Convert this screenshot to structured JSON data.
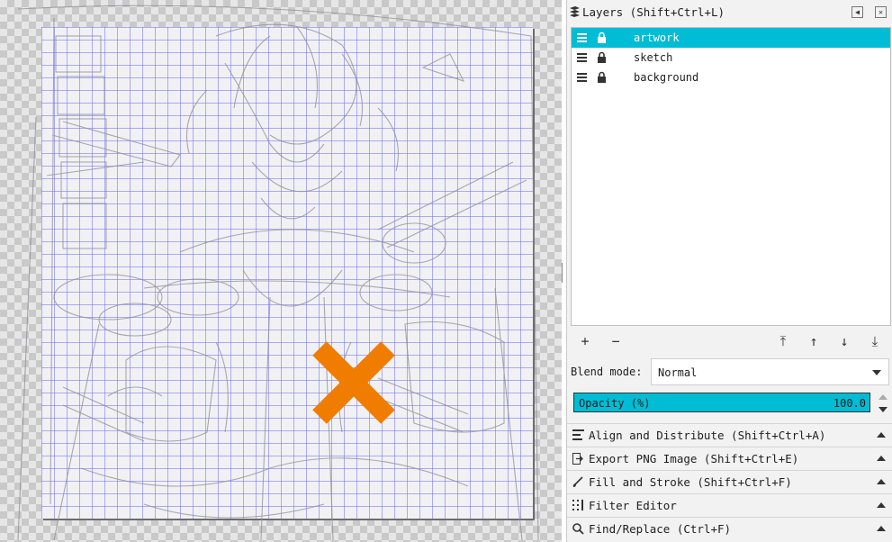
{
  "canvas": {
    "marker_color": "#f07d00"
  },
  "layers_panel": {
    "title": "Layers (Shift+Ctrl+L)",
    "header_icon": "layers-icon",
    "layers": [
      {
        "name": "artwork",
        "selected": true
      },
      {
        "name": "sketch",
        "selected": false
      },
      {
        "name": "background",
        "selected": false
      }
    ],
    "toolbar": {
      "add": "+",
      "remove": "−",
      "raise_to_top": "⤒",
      "raise": "↑",
      "lower": "↓",
      "lower_to_bottom": "⤓"
    },
    "blend_mode_label": "Blend mode:",
    "blend_mode_value": "Normal",
    "opacity_label": "Opacity (%)",
    "opacity_value": "100.0",
    "opacity_fraction": 1.0,
    "accent_color": "#00bcd4"
  },
  "docked_dialogs": [
    {
      "label": "Align and Distribute (Shift+Ctrl+A)",
      "icon": "align-icon"
    },
    {
      "label": "Export PNG Image (Shift+Ctrl+E)",
      "icon": "export-icon"
    },
    {
      "label": "Fill and Stroke (Shift+Ctrl+F)",
      "icon": "brush-icon"
    },
    {
      "label": "Filter Editor",
      "icon": "filter-icon"
    },
    {
      "label": "Find/Replace (Ctrl+F)",
      "icon": "search-icon"
    }
  ]
}
